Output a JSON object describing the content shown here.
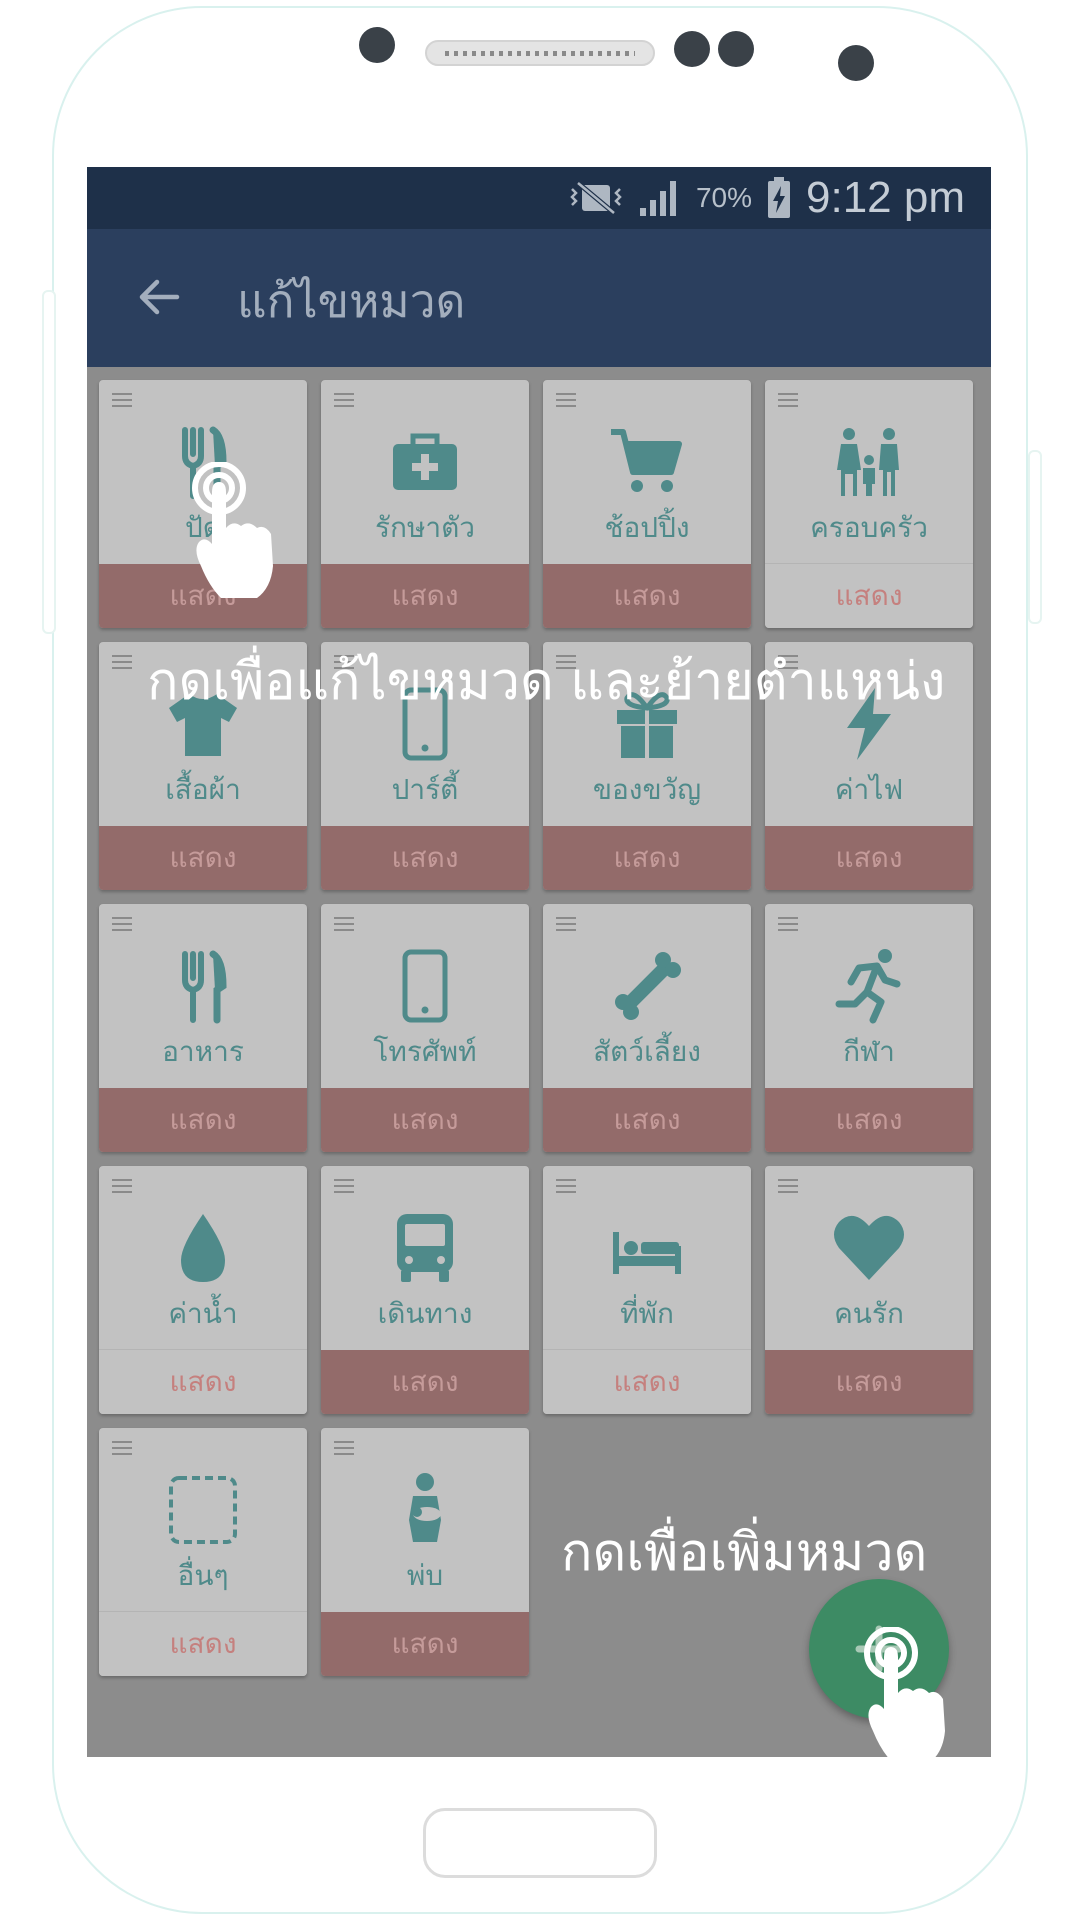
{
  "status_bar": {
    "battery": "70%",
    "time": "9:12 pm"
  },
  "app_bar": {
    "title": "แก้ไขหมวด"
  },
  "categories": [
    {
      "label": "ปัด",
      "icon": "fork-knife-icon",
      "status": "แสดง",
      "active": true
    },
    {
      "label": "รักษาตัว",
      "icon": "medical-kit-icon",
      "status": "แสดง",
      "active": true
    },
    {
      "label": "ช้อปปิ้ง",
      "icon": "shopping-cart-icon",
      "status": "แสดง",
      "active": true
    },
    {
      "label": "ครอบครัว",
      "icon": "family-icon",
      "status": "แสดง",
      "active": false
    },
    {
      "label": "เสื้อผ้า",
      "icon": "tshirt-icon",
      "status": "แสดง",
      "active": true
    },
    {
      "label": "ปาร์ตี้",
      "icon": "mobile-phone-icon",
      "status": "แสดง",
      "active": true
    },
    {
      "label": "ของขวัญ",
      "icon": "gift-icon",
      "status": "แสดง",
      "active": true
    },
    {
      "label": "ค่าไฟ",
      "icon": "lightning-icon",
      "status": "แสดง",
      "active": true
    },
    {
      "label": "อาหาร",
      "icon": "fork-knife-icon",
      "status": "แสดง",
      "active": true
    },
    {
      "label": "โทรศัพท์",
      "icon": "mobile-phone-icon",
      "status": "แสดง",
      "active": true
    },
    {
      "label": "สัตว์เลี้ยง",
      "icon": "bone-icon",
      "status": "แสดง",
      "active": true
    },
    {
      "label": "กีฬา",
      "icon": "running-icon",
      "status": "แสดง",
      "active": true
    },
    {
      "label": "ค่าน้ำ",
      "icon": "water-drop-icon",
      "status": "แสดง",
      "active": false
    },
    {
      "label": "เดินทาง",
      "icon": "bus-icon",
      "status": "แสดง",
      "active": true
    },
    {
      "label": "ที่พัก",
      "icon": "bed-icon",
      "status": "แสดง",
      "active": false
    },
    {
      "label": "คนรัก",
      "icon": "heart-icon",
      "status": "แสดง",
      "active": true
    },
    {
      "label": "อื่นๆ",
      "icon": "dashed-square-icon",
      "status": "แสดง",
      "active": false
    },
    {
      "label": "พ่บ",
      "icon": "mother-baby-icon",
      "status": "แสดง",
      "active": true
    }
  ],
  "hints": {
    "edit": "กดเพื่อแก้ไขหมวด และย้ายตำแหน่ง",
    "add": "กดเพื่อเพิ่มหมวด"
  },
  "colors": {
    "status_bar": "#1e3049",
    "app_bar": "#2b3f5e",
    "icon_teal": "#4f8a8a",
    "show_active": "#936b6a",
    "fab": "#3d8b64"
  }
}
